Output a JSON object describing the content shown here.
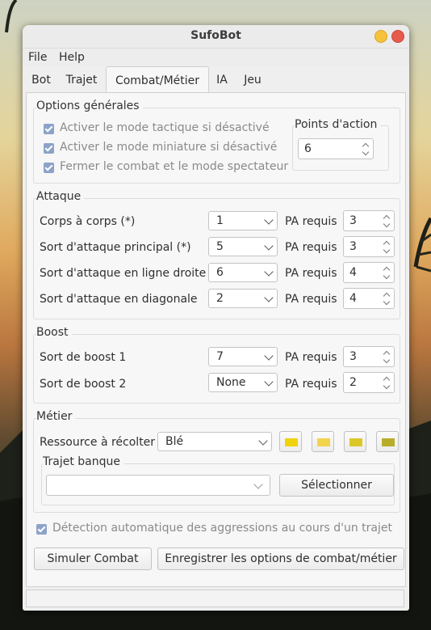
{
  "window": {
    "title": "SufoBot"
  },
  "menubar": {
    "file": "File",
    "help": "Help"
  },
  "tabs": {
    "bot": "Bot",
    "trajet": "Trajet",
    "combat": "Combat/Métier",
    "ia": "IA",
    "jeu": "Jeu",
    "active": "Combat/Métier"
  },
  "general": {
    "title": "Options générales",
    "opt1": "Activer le mode tactique si désactivé",
    "opt2": "Activer le mode miniature si désactivé",
    "opt3": "Fermer le combat et le mode spectateur",
    "pa_title": "Points d'action",
    "pa_value": "6"
  },
  "attack": {
    "title": "Attaque",
    "pa_label": "PA requis",
    "rows": [
      {
        "label": "Corps à corps (*)",
        "spell": "1",
        "pa": "3"
      },
      {
        "label": "Sort d'attaque principal (*)",
        "spell": "5",
        "pa": "3"
      },
      {
        "label": "Sort d'attaque en ligne droite",
        "spell": "6",
        "pa": "4"
      },
      {
        "label": "Sort d'attaque en diagonale",
        "spell": "2",
        "pa": "4"
      }
    ]
  },
  "boost": {
    "title": "Boost",
    "pa_label": "PA requis",
    "rows": [
      {
        "label": "Sort de boost 1",
        "spell": "7",
        "pa": "3"
      },
      {
        "label": "Sort de boost 2",
        "spell": "None",
        "pa": "2"
      }
    ]
  },
  "metier": {
    "title": "Métier",
    "resource_label": "Ressource à récolter",
    "resource_value": "Blé",
    "swatch_colors": [
      "#f0d30a",
      "#f2d44a",
      "#dcc72a",
      "#b8ad2a"
    ],
    "bank_title": "Trajet banque",
    "bank_path_value": "",
    "select_button": "Sélectionner"
  },
  "detect": {
    "label": "Détection automatique des aggressions au cours d'un trajet"
  },
  "buttons": {
    "simulate": "Simuler Combat",
    "save": "Enregistrer les options de combat/métier"
  }
}
